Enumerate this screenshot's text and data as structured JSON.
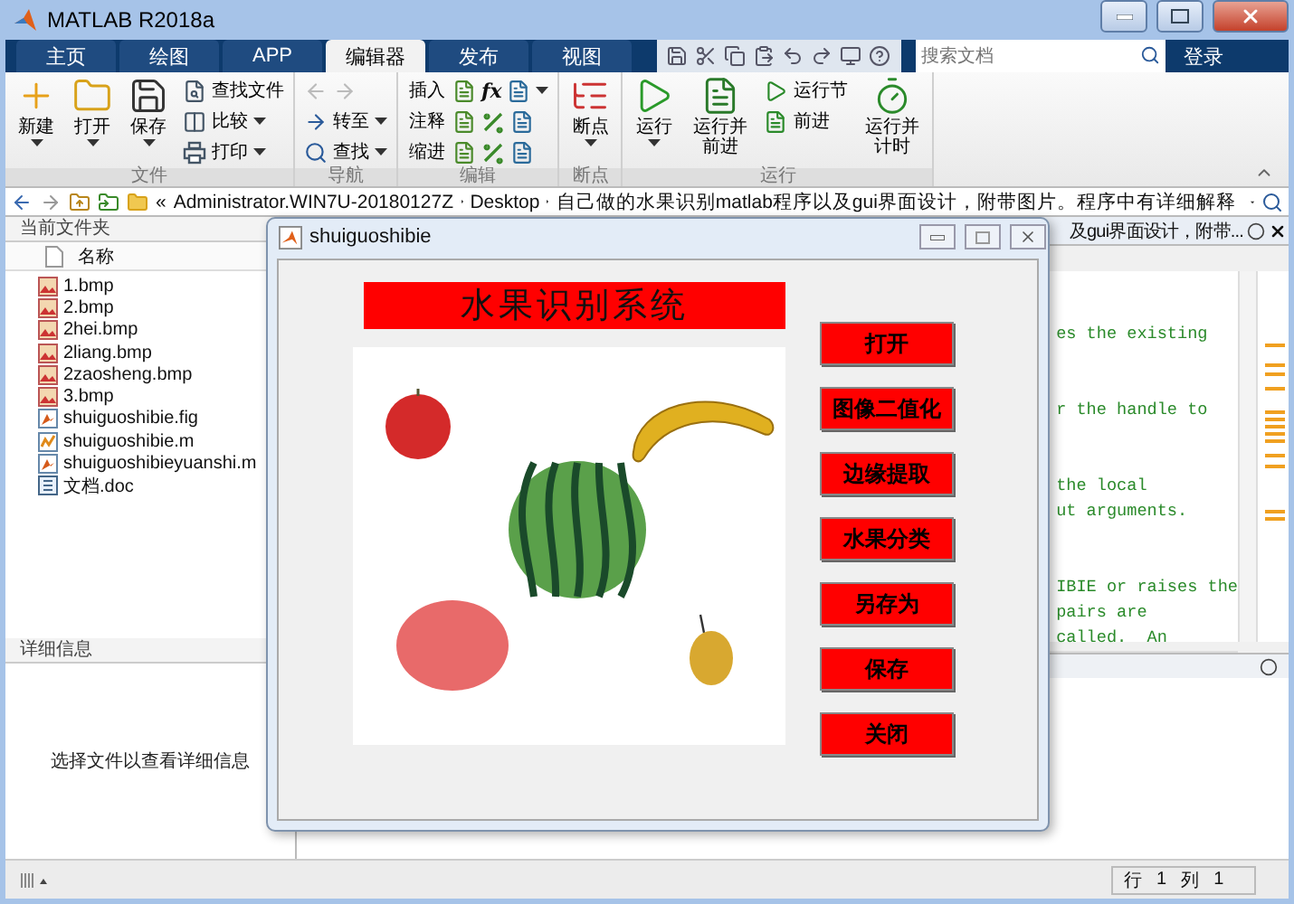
{
  "window": {
    "title": "MATLAB R2018a"
  },
  "tabs": [
    {
      "label": "主页",
      "selected": false
    },
    {
      "label": "绘图",
      "selected": false
    },
    {
      "label": "APP",
      "selected": false
    },
    {
      "label": "编辑器",
      "selected": true
    },
    {
      "label": "发布",
      "selected": false
    },
    {
      "label": "视图",
      "selected": false
    }
  ],
  "search": {
    "placeholder": "搜索文档"
  },
  "login": "登录",
  "ribbon": [
    {
      "kind": "file",
      "label": "文件",
      "large": [
        {
          "label": "新建",
          "caret": true
        },
        {
          "label": "打开",
          "caret": true
        },
        {
          "label": "保存",
          "caret": true
        }
      ],
      "rows": [
        {
          "label": "查找文件",
          "caret": false
        },
        {
          "label": "比较",
          "caret": true
        },
        {
          "label": "打印",
          "caret": true
        }
      ]
    },
    {
      "kind": "nav",
      "label": "导航",
      "arrows_disabled": true,
      "rows": [
        {
          "label": "转至",
          "caret": true
        },
        {
          "label": "查找",
          "caret": true
        }
      ]
    },
    {
      "kind": "edit",
      "label": "编辑",
      "fx": "fx",
      "rows": [
        {
          "label": "插入"
        },
        {
          "label": "注释"
        },
        {
          "label": "缩进"
        }
      ]
    },
    {
      "kind": "breakpoint",
      "label": "断点",
      "large": [
        {
          "label": "断点",
          "caret": true
        }
      ]
    },
    {
      "kind": "run",
      "label": "运行",
      "large": [
        {
          "label": "运行",
          "caret": true
        },
        {
          "label": "运行并前进",
          "caret": false
        }
      ],
      "rows": [
        {
          "label": "运行节"
        },
        {
          "label": "前进"
        }
      ],
      "timed": {
        "label": "运行并计时"
      }
    }
  ],
  "address": {
    "prefix": "«",
    "segments": [
      "Administrator.WIN7U-20180127Z",
      "Desktop",
      "自己做的水果识别matlab程序以及gui界面设计，附带图片。程序中有详细解释"
    ]
  },
  "folder_panel": {
    "title": "当前文件夹",
    "column": "名称",
    "files": [
      {
        "name": "1.bmp",
        "kind": "image"
      },
      {
        "name": "2.bmp",
        "kind": "image"
      },
      {
        "name": "2hei.bmp",
        "kind": "image"
      },
      {
        "name": "2liang.bmp",
        "kind": "image"
      },
      {
        "name": "2zaosheng.bmp",
        "kind": "image"
      },
      {
        "name": "3.bmp",
        "kind": "image"
      },
      {
        "name": "shuiguoshibie.fig",
        "kind": "fig"
      },
      {
        "name": "shuiguoshibie.m",
        "kind": "script"
      },
      {
        "name": "shuiguoshibieyuanshi.m",
        "kind": "fig"
      },
      {
        "name": "文档.doc",
        "kind": "doc"
      }
    ]
  },
  "details_panel": {
    "title": "详细信息",
    "message": "选择文件以查看详细信息"
  },
  "editor": {
    "tab_title": "及gui界面设计，附带...",
    "blocks": [
      [
        "es the existing"
      ],
      [
        "r the handle to"
      ],
      [
        "the local",
        "ut arguments."
      ],
      [
        "IBIE or raises the",
        "pairs are",
        "called.  An"
      ]
    ]
  },
  "status_bar": {
    "row_label": "行",
    "row": "1",
    "col_label": "列",
    "col": "1"
  },
  "dialog": {
    "title": "shuiguoshibie",
    "heading": "水果识别系统",
    "buttons": [
      "打开",
      "图像二值化",
      "边缘提取",
      "水果分类",
      "另存为",
      "保存",
      "关闭"
    ]
  }
}
